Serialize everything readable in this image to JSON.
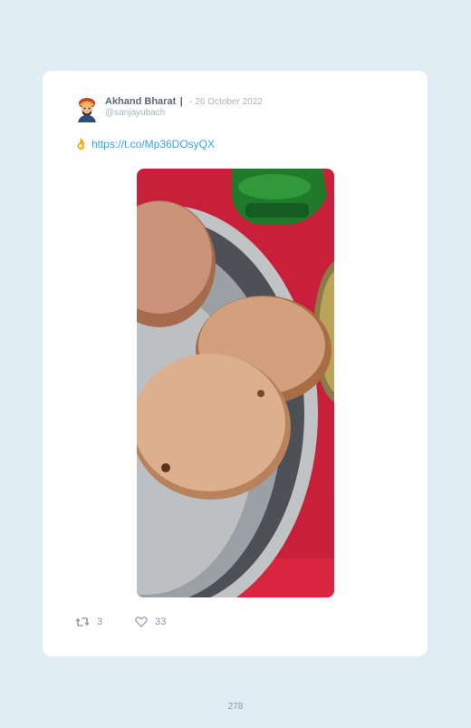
{
  "tweet": {
    "author_name": "Akhand Bharat",
    "name_separator": "|",
    "date": "- 26 October 2022",
    "handle": "@sanjayubach",
    "emoji": "👌",
    "link_text": "https://t.co/Mp36DOsyQX",
    "retweets": "3",
    "likes": "33"
  },
  "page": {
    "number": "278"
  },
  "icons": {
    "avatar": "avatar-illustration",
    "retweet": "retweet-icon",
    "like": "heart-icon"
  }
}
